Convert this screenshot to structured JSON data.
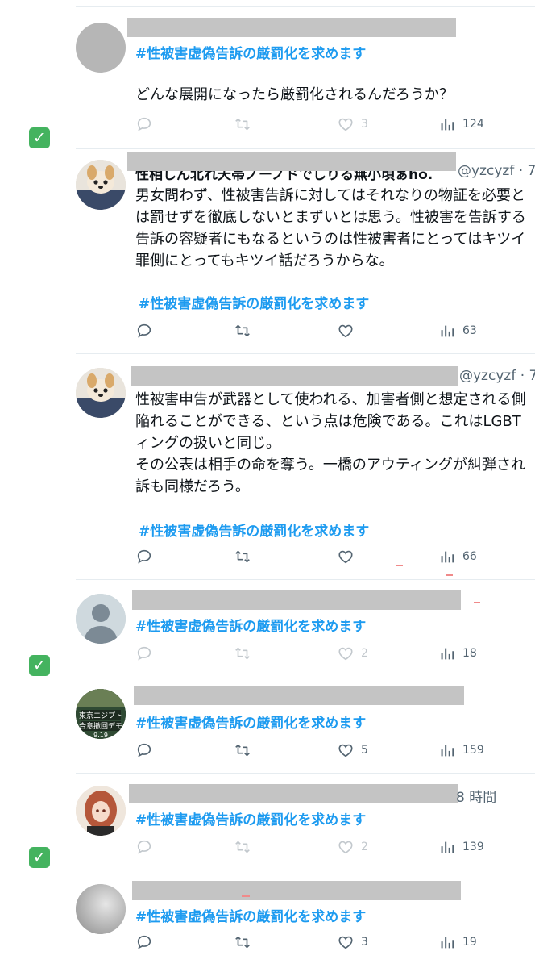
{
  "hashtag": "#性被害虚偽告訴の厳罰化を求めます",
  "tweets": [
    {
      "body_lines": [
        "どんな展開になったら厳罰化されるんだろうか？"
      ],
      "likes": "3",
      "views": "124"
    },
    {
      "header_partial": "性相しん北れ天帯ノーノドでしりる無小頃ぁho.",
      "handle": "@yzcyzf · 7",
      "body_lines": [
        "男女問わず、性被害告訴に対してはそれなりの物証を必要と",
        "は罰せずを徹底しないとまずいとは思う。性被害を告訴する",
        "告訴の容疑者にもなるというのは性被害者にとってはキツイ",
        "罪側にとってもキツイ話だろうからな。"
      ],
      "likes": "",
      "views": "63"
    },
    {
      "handle": "@yzcyzf · 7",
      "body_lines": [
        "性被害申告が武器として使われる、加害者側と想定される側",
        "陥れることができる、という点は危険である。これはLGBT",
        "ィングの扱いと同じ。",
        "その公表は相手の命を奪う。一橋のアウティングが糾弾され",
        "訴も同様だろう。"
      ],
      "likes": "",
      "views": "66"
    },
    {
      "likes": "2",
      "views": "18"
    },
    {
      "avatar_text": [
        "東京エジプト",
        "合意撤回デモ",
        "9.19"
      ],
      "likes": "5",
      "views": "159"
    },
    {
      "time": "8 時間",
      "likes": "2",
      "views": "139"
    },
    {
      "likes": "3",
      "views": "19"
    }
  ],
  "check_mark": "✓",
  "icons": [
    "reply-icon",
    "retweet-icon",
    "like-icon",
    "views-icon",
    "check-icon"
  ]
}
